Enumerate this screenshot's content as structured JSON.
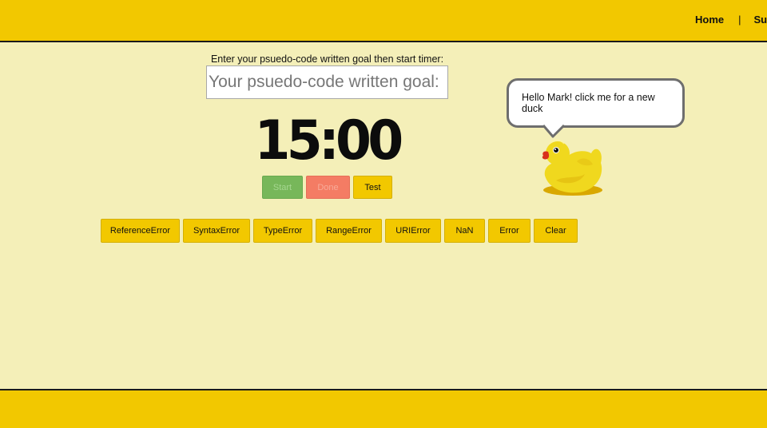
{
  "nav": {
    "items": [
      {
        "label": "Home"
      },
      {
        "label": "Sur"
      }
    ],
    "separator": "|"
  },
  "goal": {
    "prompt": "Enter your psuedo-code written goal then start timer:",
    "placeholder": "Your psuedo-code written goal:",
    "value": ""
  },
  "timer": {
    "display": "15:00"
  },
  "controls": {
    "start_label": "Start",
    "done_label": "Done",
    "test_label": "Test"
  },
  "error_buttons": [
    {
      "label": "ReferenceError"
    },
    {
      "label": "SyntaxError"
    },
    {
      "label": "TypeError"
    },
    {
      "label": "RangeError"
    },
    {
      "label": "URIError"
    },
    {
      "label": "NaN"
    },
    {
      "label": "Error"
    },
    {
      "label": "Clear"
    }
  ],
  "duck": {
    "message": "Hello Mark! click me for a new duck",
    "icon": "rubber-duck-icon"
  },
  "colors": {
    "header": "#f2c800",
    "background": "#f4efb8",
    "start": "#77b75a",
    "done": "#f47c64",
    "button": "#f2c800"
  }
}
